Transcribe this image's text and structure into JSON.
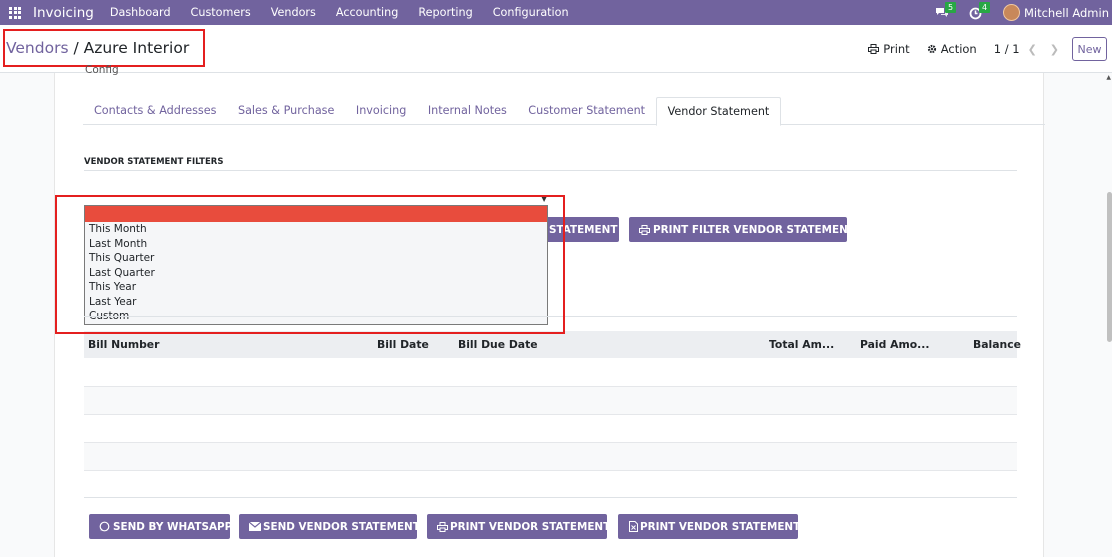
{
  "navbar": {
    "app_name": "Invoicing",
    "menu": [
      "Dashboard",
      "Customers",
      "Vendors",
      "Accounting",
      "Reporting",
      "Configuration"
    ],
    "messages_count": "5",
    "activities_count": "4",
    "user_name": "Mitchell Admin"
  },
  "breadcrumb": {
    "parent": "Vendors",
    "separator": " / ",
    "current": "Azure Interior"
  },
  "control_panel": {
    "print_label": "Print",
    "action_label": "Action",
    "pager": "1 / 1",
    "new_label": "New"
  },
  "sheet": {
    "partial_field_text": "Config"
  },
  "tabs": [
    "Contacts & Addresses",
    "Sales & Purchase",
    "Invoicing",
    "Internal Notes",
    "Customer Statement",
    "Vendor Statement"
  ],
  "active_tab_index": 5,
  "filters": {
    "title": "VENDOR STATEMENT FILTERS",
    "dropdown_selected": "",
    "dropdown_options": [
      "This Month",
      "Last Month",
      "This Quarter",
      "Last Quarter",
      "This Year",
      "Last Year",
      "Custom"
    ],
    "send_filter_button_visible_text": "STATEMENT",
    "print_filter_button": "PRINT FILTER VENDOR STATEMENT"
  },
  "table": {
    "columns": [
      "Bill Number",
      "Bill Date",
      "Bill Due Date",
      "Total Am...",
      "Paid Amo...",
      "Balance"
    ],
    "rows": [
      [],
      [],
      [],
      []
    ]
  },
  "bottom_buttons": {
    "whatsapp": "SEND BY WHATSAPP",
    "send": "SEND VENDOR STATEMENT",
    "print": "PRINT VENDOR STATEMENT",
    "print_xls": "PRINT VENDOR STATEMENT"
  },
  "colors": {
    "brand": "#71639e",
    "badge": "#28a745",
    "highlight": "#e41f1f",
    "selected_option": "#e84c3d"
  }
}
